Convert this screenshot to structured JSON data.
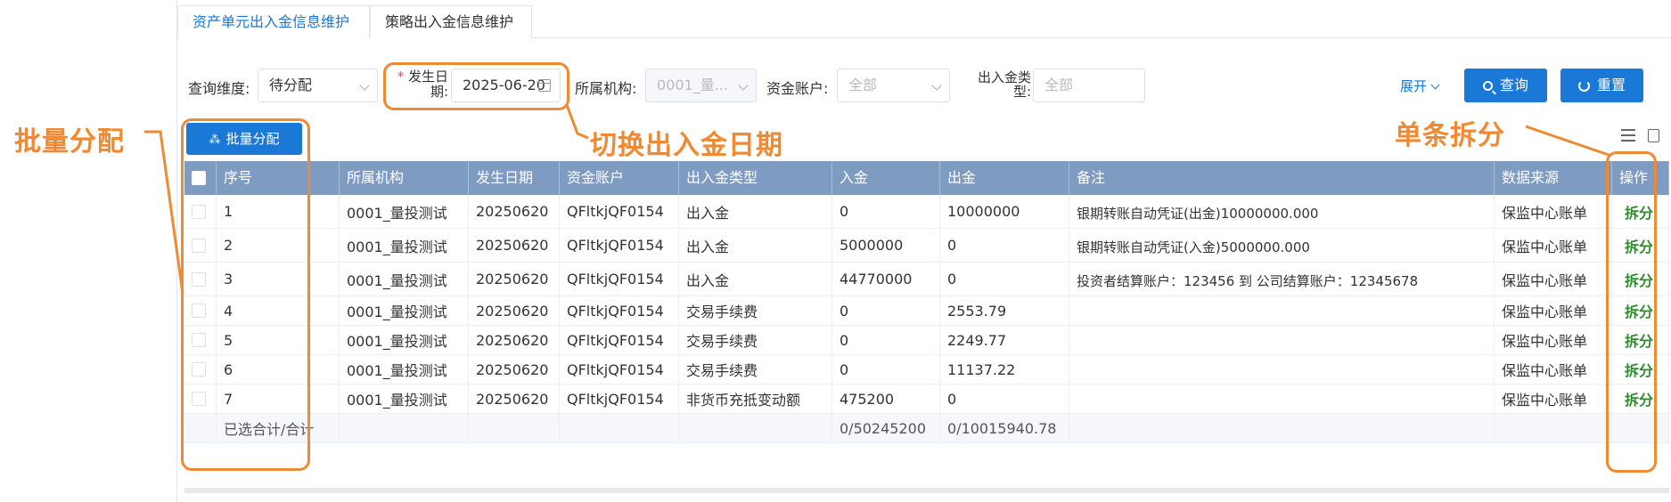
{
  "tabs": [
    {
      "label": "资产单元出入金信息维护",
      "active": true
    },
    {
      "label": "策略出入金信息维护",
      "active": false
    }
  ],
  "filters": {
    "query_dimension": {
      "label": "查询维度:",
      "value": "待分配"
    },
    "occur_date": {
      "required_mark": "*",
      "label_line1": "发生日",
      "label_line2": "期:",
      "value": "2025-06-20"
    },
    "org": {
      "label": "所属机构:",
      "value": "0001_量..."
    },
    "fund_account": {
      "label": "资金账户:",
      "placeholder": "全部"
    },
    "cash_type": {
      "label_line1": "出入金类",
      "label_line2": "型:",
      "placeholder": "全部"
    },
    "expand_label": "展开"
  },
  "buttons": {
    "query": "查询",
    "reset": "重置",
    "batch_assign": "批量分配"
  },
  "table": {
    "headers": [
      "序号",
      "所属机构",
      "发生日期",
      "资金账户",
      "出入金类型",
      "入金",
      "出金",
      "备注",
      "数据来源",
      "操作"
    ],
    "rows": [
      {
        "no": "1",
        "org": "0001_量投测试",
        "date": "20250620",
        "account": "QFltkjQF0154",
        "type": "出入金",
        "in": "0",
        "out": "10000000",
        "remark": "银期转账自动凭证(出金)10000000.000",
        "source": "保监中心账单",
        "op": "拆分"
      },
      {
        "no": "2",
        "org": "0001_量投测试",
        "date": "20250620",
        "account": "QFltkjQF0154",
        "type": "出入金",
        "in": "5000000",
        "out": "0",
        "remark": "银期转账自动凭证(入金)5000000.000",
        "source": "保监中心账单",
        "op": "拆分"
      },
      {
        "no": "3",
        "org": "0001_量投测试",
        "date": "20250620",
        "account": "QFltkjQF0154",
        "type": "出入金",
        "in": "44770000",
        "out": "0",
        "remark": "投资者结算账户：123456 到 公司结算账户：12345678",
        "source": "保监中心账单",
        "op": "拆分"
      },
      {
        "no": "4",
        "org": "0001_量投测试",
        "date": "20250620",
        "account": "QFltkjQF0154",
        "type": "交易手续费",
        "in": "0",
        "out": "2553.79",
        "remark": "",
        "source": "保监中心账单",
        "op": "拆分"
      },
      {
        "no": "5",
        "org": "0001_量投测试",
        "date": "20250620",
        "account": "QFltkjQF0154",
        "type": "交易手续费",
        "in": "0",
        "out": "2249.77",
        "remark": "",
        "source": "保监中心账单",
        "op": "拆分"
      },
      {
        "no": "6",
        "org": "0001_量投测试",
        "date": "20250620",
        "account": "QFltkjQF0154",
        "type": "交易手续费",
        "in": "0",
        "out": "11137.22",
        "remark": "",
        "source": "保监中心账单",
        "op": "拆分"
      },
      {
        "no": "7",
        "org": "0001_量投测试",
        "date": "20250620",
        "account": "QFltkjQF0154",
        "type": "非货币充抵变动额",
        "in": "475200",
        "out": "0",
        "remark": "",
        "source": "保监中心账单",
        "op": "拆分"
      }
    ],
    "summary": {
      "label": "已选合计/合计",
      "in": "0/50245200",
      "out": "0/10015940.78"
    }
  },
  "annotations": {
    "batch": "批量分配",
    "switch_date": "切换出入金日期",
    "single_split": "单条拆分",
    "color": "#f08a32"
  }
}
